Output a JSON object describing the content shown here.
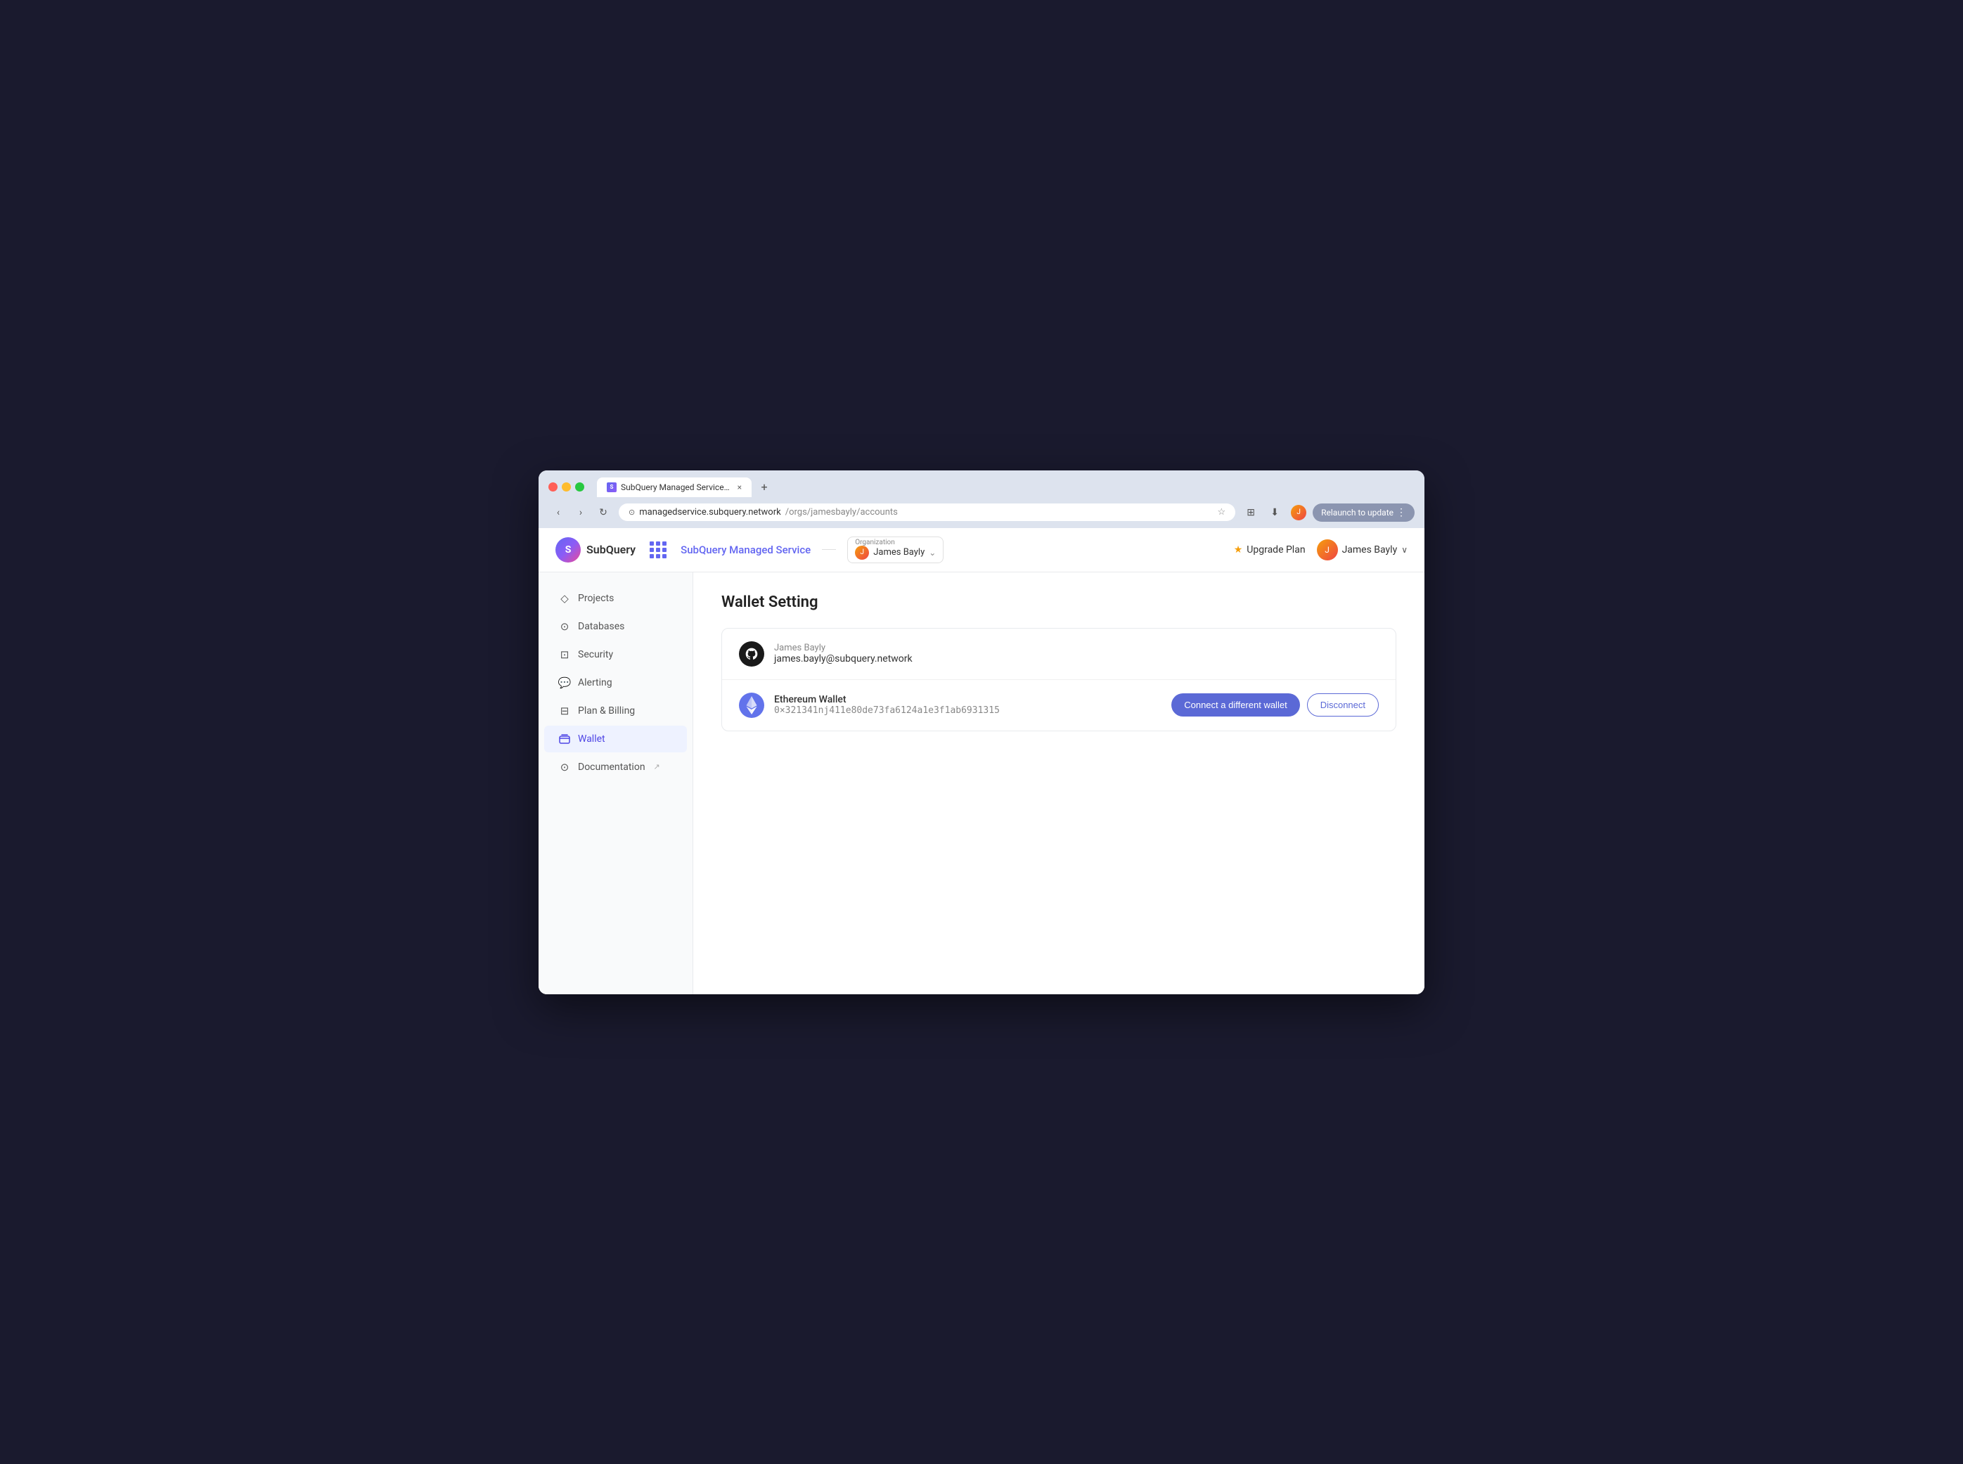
{
  "browser": {
    "tab_title": "SubQuery Managed Service –",
    "tab_close": "×",
    "tab_new": "+",
    "url_base": "managedservice.subquery.network",
    "url_path": "/orgs/jamesbayly/accounts",
    "relaunch_label": "Relaunch to update",
    "nav_back": "‹",
    "nav_forward": "›",
    "nav_refresh": "↻"
  },
  "header": {
    "logo_text": "SubQuery",
    "service_name": "SubQuery Managed Service",
    "org_label": "Organization",
    "org_name": "James Bayly",
    "upgrade_label": "Upgrade Plan",
    "user_name": "James Bayly",
    "user_chevron": "∨"
  },
  "sidebar": {
    "items": [
      {
        "id": "projects",
        "label": "Projects",
        "icon": "◇"
      },
      {
        "id": "databases",
        "label": "Databases",
        "icon": "⊙"
      },
      {
        "id": "security",
        "label": "Security",
        "icon": "⊡"
      },
      {
        "id": "alerting",
        "label": "Alerting",
        "icon": "□"
      },
      {
        "id": "plan-billing",
        "label": "Plan & Billing",
        "icon": "⊟"
      },
      {
        "id": "wallet",
        "label": "Wallet",
        "icon": "⊏",
        "active": true
      },
      {
        "id": "documentation",
        "label": "Documentation",
        "icon": "⊙"
      }
    ]
  },
  "main": {
    "page_title": "Wallet Setting",
    "user_section": {
      "username": "James Bayly",
      "email": "james.bayly@subquery.network"
    },
    "wallet_section": {
      "wallet_type": "Ethereum Wallet",
      "wallet_address": "0×321341nj411e80de73fa6124a1e3f1ab6931315",
      "connect_btn": "Connect a different wallet",
      "disconnect_btn": "Disconnect"
    }
  }
}
